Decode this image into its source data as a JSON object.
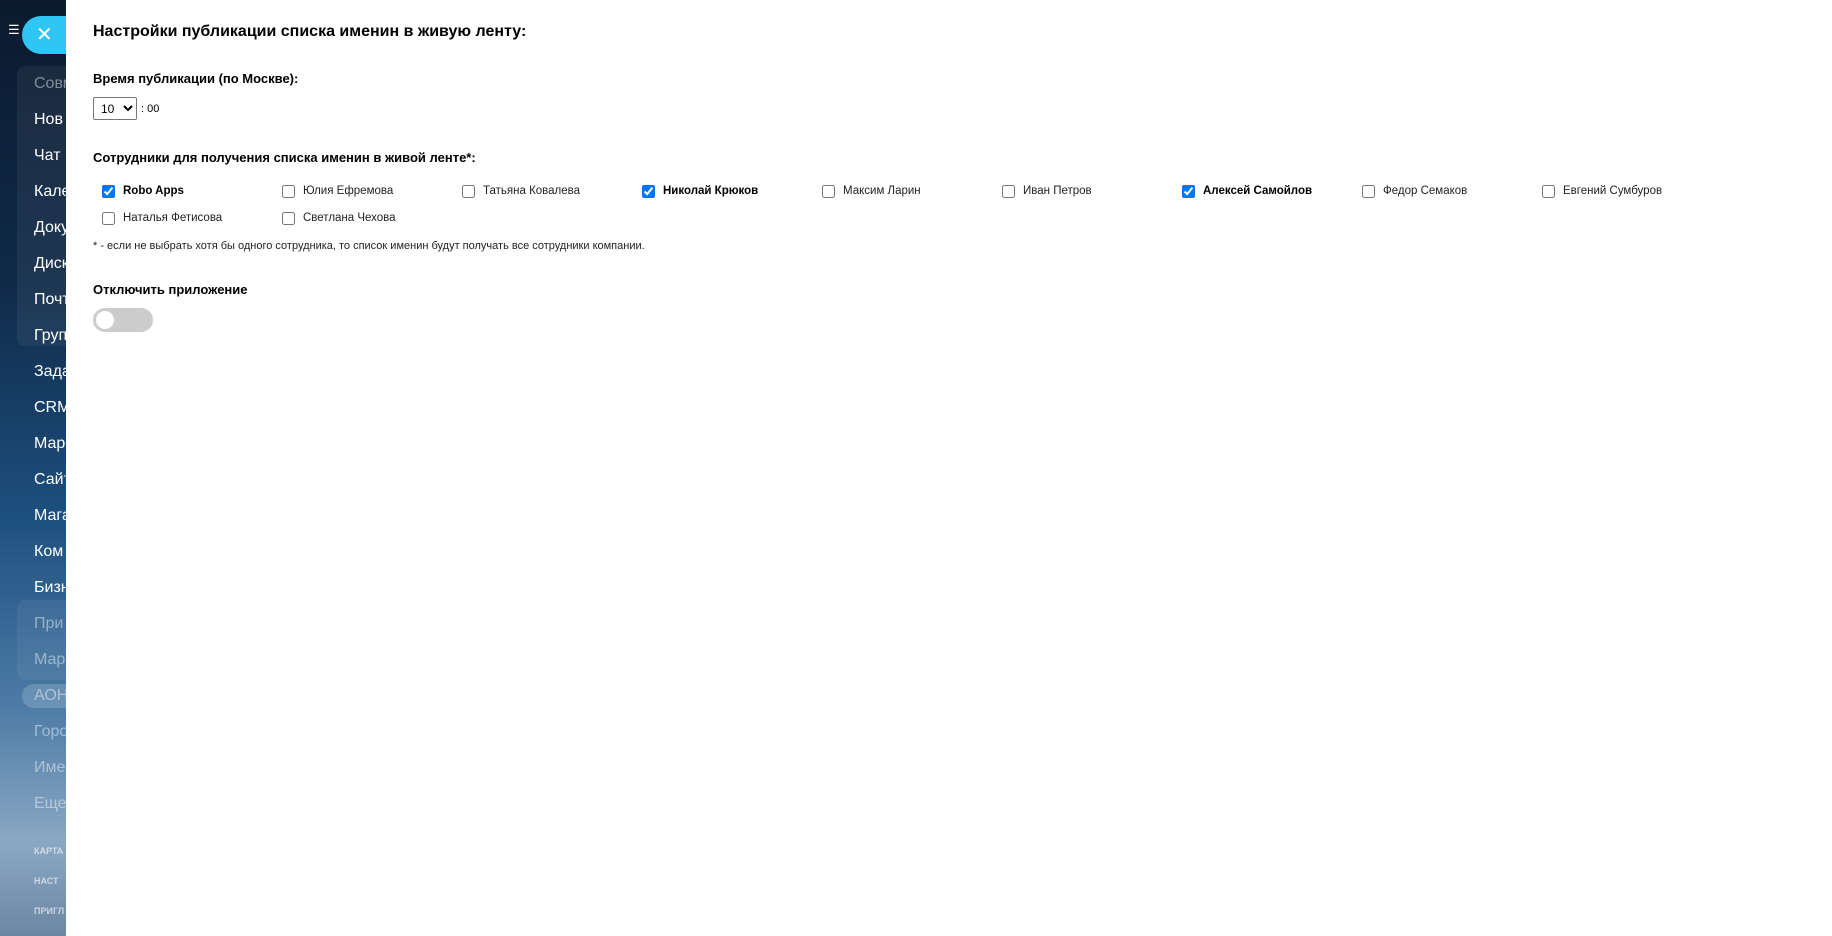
{
  "background_sidebar": {
    "menu_icon": "menu-icon",
    "items": [
      {
        "label": "Совм",
        "dim": true
      },
      {
        "label": "Нов",
        "dim": false
      },
      {
        "label": "Чат",
        "dim": false
      },
      {
        "label": "Кале",
        "dim": false
      },
      {
        "label": "Доку",
        "dim": false
      },
      {
        "label": "Диск",
        "dim": false
      },
      {
        "label": "Почт",
        "dim": false
      },
      {
        "label": "Груп",
        "dim": false
      },
      {
        "label": "Зада",
        "dim": false
      },
      {
        "label": "CRM",
        "dim": false
      },
      {
        "label": "Мар",
        "dim": false
      },
      {
        "label": "Сайт",
        "dim": false
      },
      {
        "label": "Мага",
        "dim": false
      },
      {
        "label": "Ком",
        "dim": false
      },
      {
        "label": "Бизн",
        "dim": false
      },
      {
        "label": "При",
        "dim": true
      },
      {
        "label": "Мар",
        "dim": true
      },
      {
        "label": "АОН",
        "dim": true
      },
      {
        "label": "Горо",
        "dim": true
      },
      {
        "label": "Име",
        "dim": true
      },
      {
        "label": "Еще",
        "dim": true
      },
      {
        "label": "КАРТА",
        "dim": true
      },
      {
        "label": "НАСТ",
        "dim": true
      },
      {
        "label": "ПРИГЛ",
        "dim": true
      }
    ]
  },
  "close_button": {
    "icon": "close-icon",
    "glyph": "✕"
  },
  "settings": {
    "title": "Настройки публикации списка именин в живую ленту:",
    "time_label": "Время публикации (по Москве):",
    "hour_value": "10",
    "hour_options": [
      "10"
    ],
    "minutes_text": ": 00",
    "employees_label": "Сотрудники для получения списка именин в живой ленте*:",
    "employees": [
      {
        "name": "Robo Apps",
        "checked": true
      },
      {
        "name": "Юлия Ефремова",
        "checked": false
      },
      {
        "name": "Татьяна Ковалева",
        "checked": false
      },
      {
        "name": "Николай Крюков",
        "checked": true
      },
      {
        "name": "Максим Ларин",
        "checked": false
      },
      {
        "name": "Иван Петров",
        "checked": false
      },
      {
        "name": "Алексей Самойлов",
        "checked": true
      },
      {
        "name": "Федор Семаков",
        "checked": false
      },
      {
        "name": "Евгений Сумбуров",
        "checked": false
      },
      {
        "name": "Наталья Фетисова",
        "checked": false
      },
      {
        "name": "Светлана Чехова",
        "checked": false
      }
    ],
    "footnote": "* - если не выбрать хотя бы одного сотрудника, то список именин будут получать все сотрудники компании.",
    "disable_label": "Отключить приложение",
    "disable_toggle_on": false
  },
  "colors": {
    "accent": "#2fc6f6",
    "checkbox": "#0075ff",
    "toggle_off": "#cccccc"
  }
}
